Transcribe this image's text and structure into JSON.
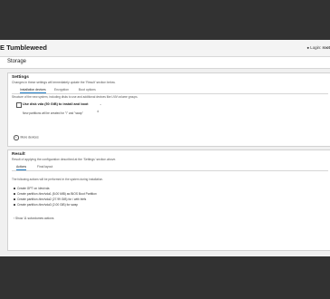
{
  "header": {
    "app_title": "E Tumbleweed",
    "login_prefix": "Login:",
    "login_account": "root"
  },
  "page": {
    "title": "Storage"
  },
  "settings": {
    "title": "Settings",
    "subtitle": "Changes in these settings will immediately update the 'Result' section below.",
    "tabs": [
      {
        "label": "Installation devices",
        "active": true
      },
      {
        "label": "Encryption",
        "active": false
      },
      {
        "label": "Boot options",
        "active": false
      }
    ],
    "tab_description": "Structure of the new system, including disks to use and additional devices like LVM volume groups.",
    "boot_disk_label": "Use disk vda (50 GiB) to install and boot",
    "boot_disk_help": "New partitions will be created for \"/\" and \"swap\"",
    "more_devices_label": "More devices"
  },
  "result": {
    "title": "Result",
    "subtitle": "Result of applying the configuration described at the 'Settings' section above.",
    "tabs": [
      {
        "label": "Actions",
        "active": true
      },
      {
        "label": "Final layout",
        "active": false
      }
    ],
    "intro": "The following actions will be performed in the system during installation.",
    "actions": [
      "Create GPT on /dev/vda",
      "Create partition /dev/vda1 (8.00 MiB) as BIOS Boot Partition",
      "Create partition /dev/vda2 (27.99 GiB) for / with btrfs",
      "Create partition /dev/vda3 (2.00 GiB) for swap"
    ],
    "subvolumes_toggle": "Show 11 subvolumes actions"
  }
}
